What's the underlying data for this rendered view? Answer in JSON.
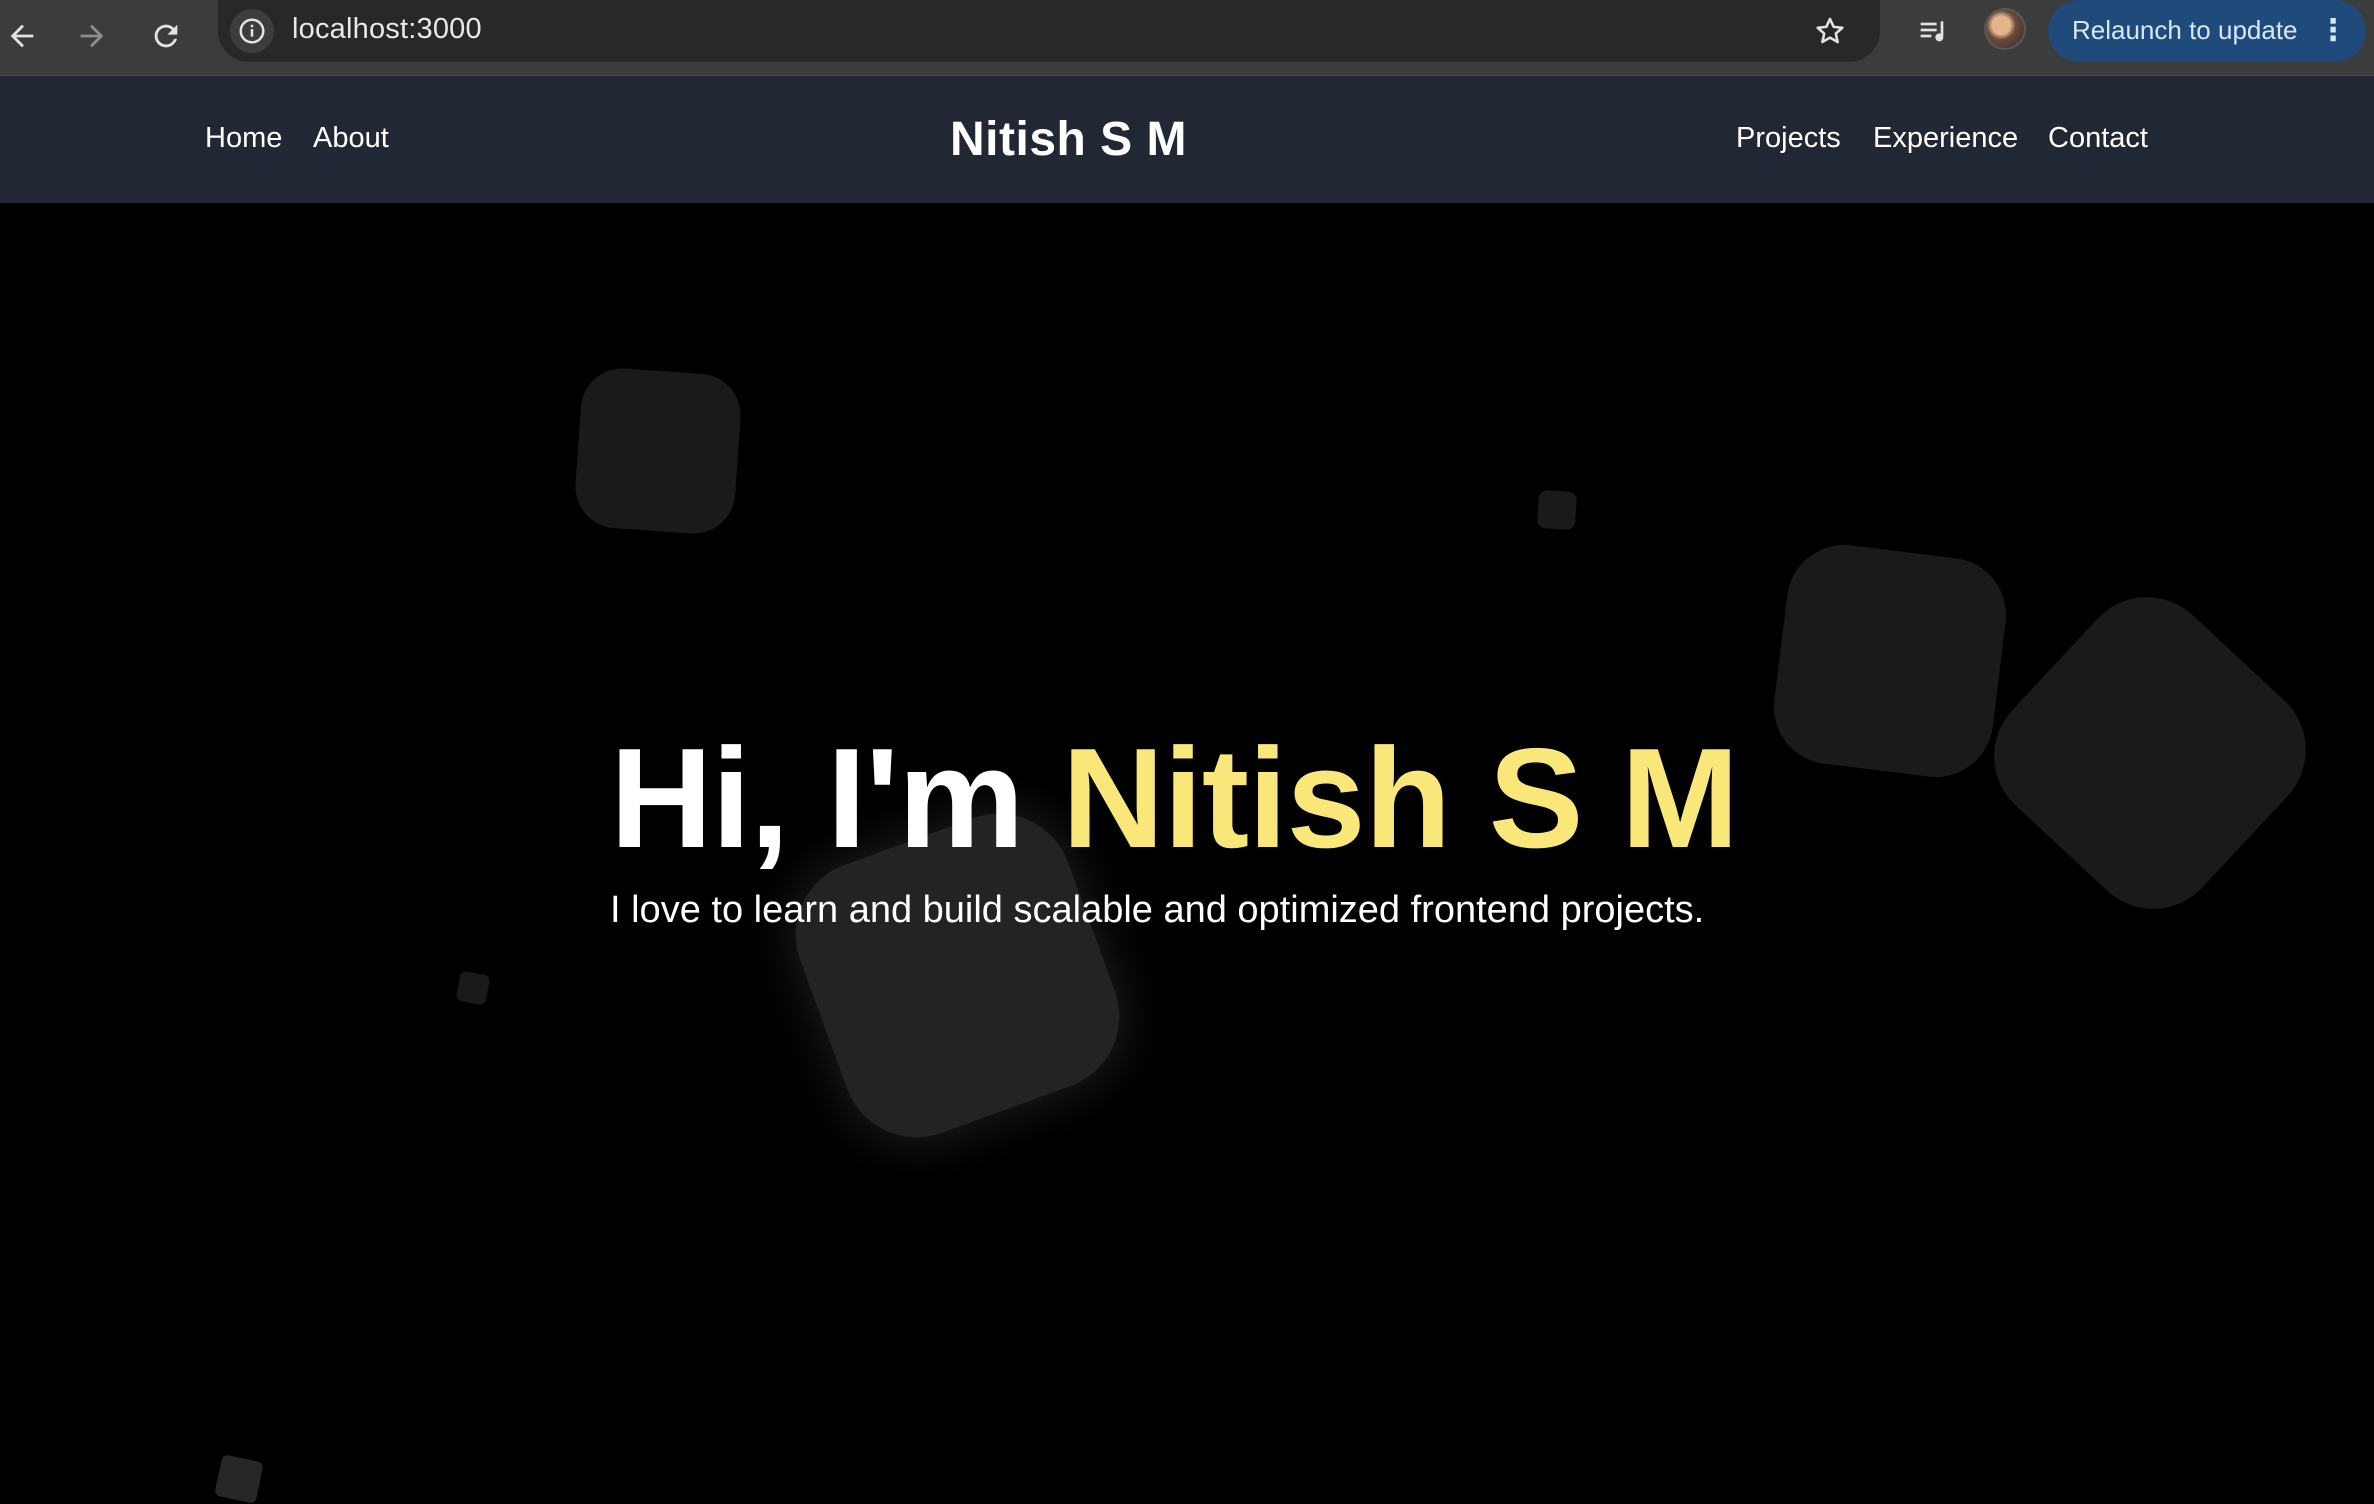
{
  "browser": {
    "url": "localhost:3000",
    "relaunch_label": "Relaunch to update",
    "icons": {
      "back": "arrow-left-icon",
      "forward": "arrow-right-icon",
      "reload": "reload-icon",
      "site_info": "info-icon",
      "bookmark": "star-icon",
      "media": "media-playlist-icon",
      "profile": "avatar",
      "menu": "kebab-menu-icon"
    }
  },
  "navbar": {
    "left_links": [
      "Home",
      "About"
    ],
    "brand": "Nitish S M",
    "right_links": [
      "Projects",
      "Experience",
      "Contact"
    ]
  },
  "hero": {
    "greeting": "Hi, I'm ",
    "name": "Nitish S M",
    "tagline": "I love to learn and build scalable and optimized frontend projects."
  },
  "colors": {
    "accent": "#f9e77a",
    "navbar_bg": "#222833",
    "page_bg": "#000000",
    "relaunch_bg": "#1f4a7a"
  }
}
